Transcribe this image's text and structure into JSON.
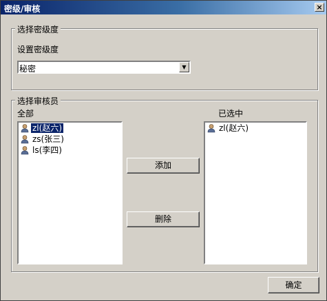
{
  "window": {
    "title": "密级/审核",
    "close_glyph": "×"
  },
  "security_group": {
    "legend": "选择密级度",
    "field_label": "设置密级度",
    "select_value": "秘密",
    "select_arrow": "▼"
  },
  "reviewer_group": {
    "legend": "选择审核员",
    "all_label": "全部",
    "selected_label": "已选中",
    "all_items": [
      {
        "label": "zl(赵六)",
        "selected": true,
        "icon": "user-icon"
      },
      {
        "label": "zs(张三)",
        "selected": false,
        "icon": "user-icon"
      },
      {
        "label": "ls(李四)",
        "selected": false,
        "icon": "user-icon"
      }
    ],
    "selected_items": [
      {
        "label": "zl(赵六)",
        "icon": "user-icon"
      }
    ],
    "add_button": "添加",
    "remove_button": "删除"
  },
  "ok_button": "确定",
  "colors": {
    "title_bar": "#0a246a",
    "face": "#d4d0c8",
    "selection": "#0a246a"
  }
}
